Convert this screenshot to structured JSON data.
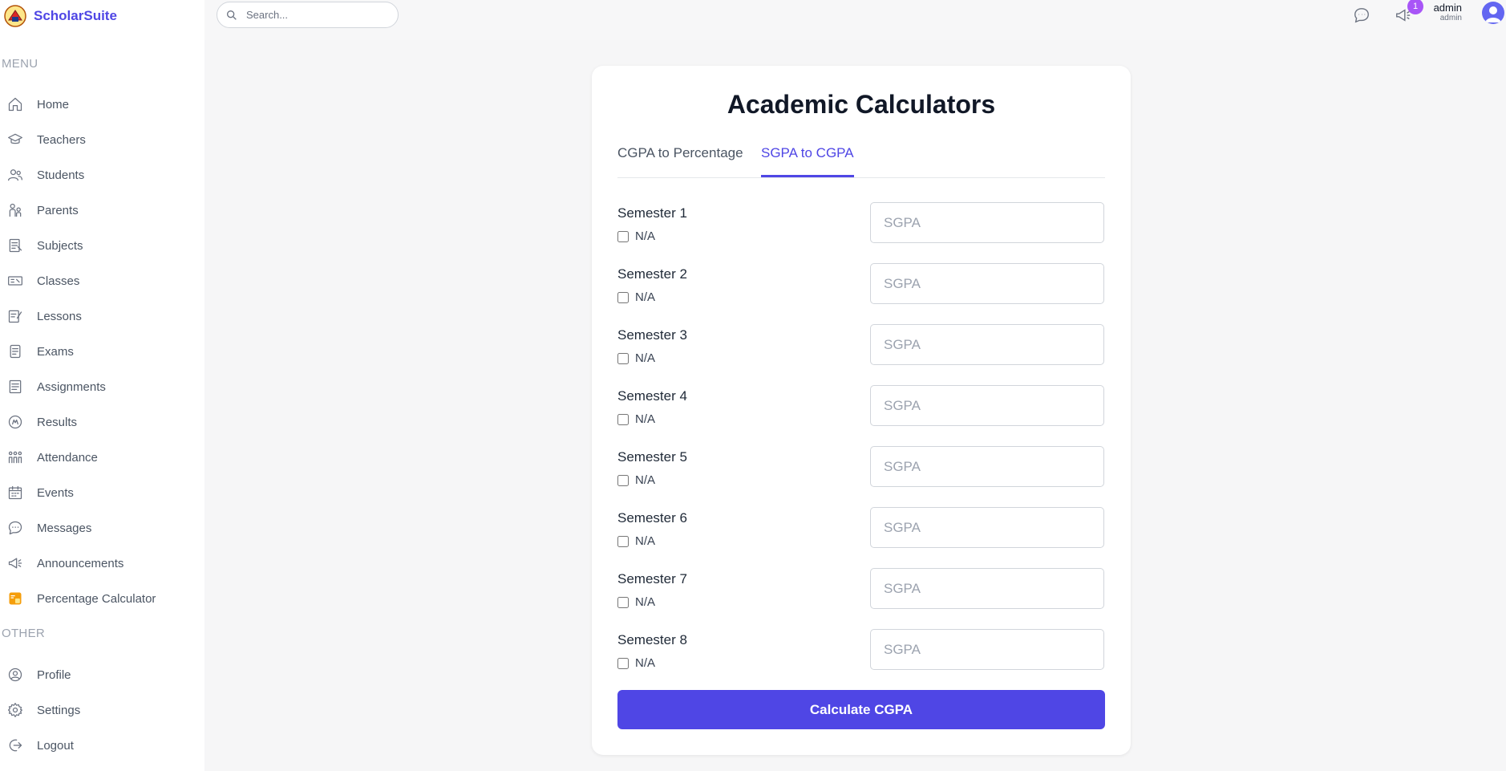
{
  "brand": {
    "name": "ScholarSuite"
  },
  "menu": {
    "label": "MENU",
    "items": [
      {
        "label": "Home",
        "icon": "home-icon"
      },
      {
        "label": "Teachers",
        "icon": "teacher-icon"
      },
      {
        "label": "Students",
        "icon": "students-icon"
      },
      {
        "label": "Parents",
        "icon": "parents-icon"
      },
      {
        "label": "Subjects",
        "icon": "subjects-icon"
      },
      {
        "label": "Classes",
        "icon": "classes-icon"
      },
      {
        "label": "Lessons",
        "icon": "lessons-icon"
      },
      {
        "label": "Exams",
        "icon": "exams-icon"
      },
      {
        "label": "Assignments",
        "icon": "assignments-icon"
      },
      {
        "label": "Results",
        "icon": "results-icon"
      },
      {
        "label": "Attendance",
        "icon": "attendance-icon"
      },
      {
        "label": "Events",
        "icon": "calendar-icon"
      },
      {
        "label": "Messages",
        "icon": "message-icon"
      },
      {
        "label": "Announcements",
        "icon": "megaphone-icon"
      },
      {
        "label": "Percentage Calculator",
        "icon": "calculator-icon"
      }
    ]
  },
  "other": {
    "label": "OTHER",
    "items": [
      {
        "label": "Profile",
        "icon": "profile-icon"
      },
      {
        "label": "Settings",
        "icon": "gear-icon"
      },
      {
        "label": "Logout",
        "icon": "logout-icon"
      }
    ]
  },
  "topbar": {
    "search_placeholder": "Search...",
    "announcement_badge": "1",
    "user_name": "admin",
    "user_role": "admin"
  },
  "card": {
    "title": "Academic Calculators",
    "tabs": [
      "CGPA to Percentage",
      "SGPA to CGPA"
    ],
    "active_tab": "SGPA to CGPA",
    "semesters": [
      {
        "label": "Semester 1",
        "na_label": "N/A",
        "placeholder": "SGPA",
        "value": ""
      },
      {
        "label": "Semester 2",
        "na_label": "N/A",
        "placeholder": "SGPA",
        "value": ""
      },
      {
        "label": "Semester 3",
        "na_label": "N/A",
        "placeholder": "SGPA",
        "value": ""
      },
      {
        "label": "Semester 4",
        "na_label": "N/A",
        "placeholder": "SGPA",
        "value": ""
      },
      {
        "label": "Semester 5",
        "na_label": "N/A",
        "placeholder": "SGPA",
        "value": ""
      },
      {
        "label": "Semester 6",
        "na_label": "N/A",
        "placeholder": "SGPA",
        "value": ""
      },
      {
        "label": "Semester 7",
        "na_label": "N/A",
        "placeholder": "SGPA",
        "value": ""
      },
      {
        "label": "Semester 8",
        "na_label": "N/A",
        "placeholder": "SGPA",
        "value": ""
      }
    ],
    "calculate_label": "Calculate CGPA"
  },
  "colors": {
    "accent": "#4f46e5",
    "badge": "#a855f7",
    "calculator_icon": "#f59e0b"
  }
}
